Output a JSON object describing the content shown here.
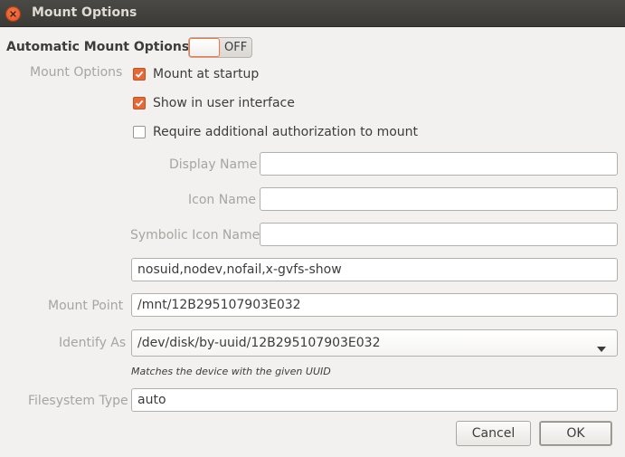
{
  "window": {
    "title": "Mount Options"
  },
  "automatic": {
    "label": "Automatic Mount Options",
    "toggle_state": "OFF"
  },
  "mount_options": {
    "label": "Mount Options",
    "checkboxes": [
      {
        "label": "Mount at startup",
        "checked": true
      },
      {
        "label": "Show in user interface",
        "checked": true
      },
      {
        "label": "Require additional authorization to mount",
        "checked": false
      }
    ]
  },
  "fields": {
    "display_name": {
      "label": "Display Name",
      "value": ""
    },
    "icon_name": {
      "label": "Icon Name",
      "value": ""
    },
    "symbolic_icon_name": {
      "label": "Symbolic Icon Name",
      "value": ""
    },
    "options": {
      "value": "nosuid,nodev,nofail,x-gvfs-show"
    },
    "mount_point": {
      "label": "Mount Point",
      "value": "/mnt/12B295107903E032"
    },
    "identify_as": {
      "label": "Identify As",
      "value": "/dev/disk/by-uuid/12B295107903E032",
      "hint": "Matches the device with the given UUID"
    },
    "filesystem_type": {
      "label": "Filesystem Type",
      "value": "auto"
    }
  },
  "buttons": {
    "cancel": "Cancel",
    "ok": "OK"
  },
  "colors": {
    "accent": "#e3693a",
    "titlebar": "#3c3b37",
    "background": "#f2f1f0"
  }
}
